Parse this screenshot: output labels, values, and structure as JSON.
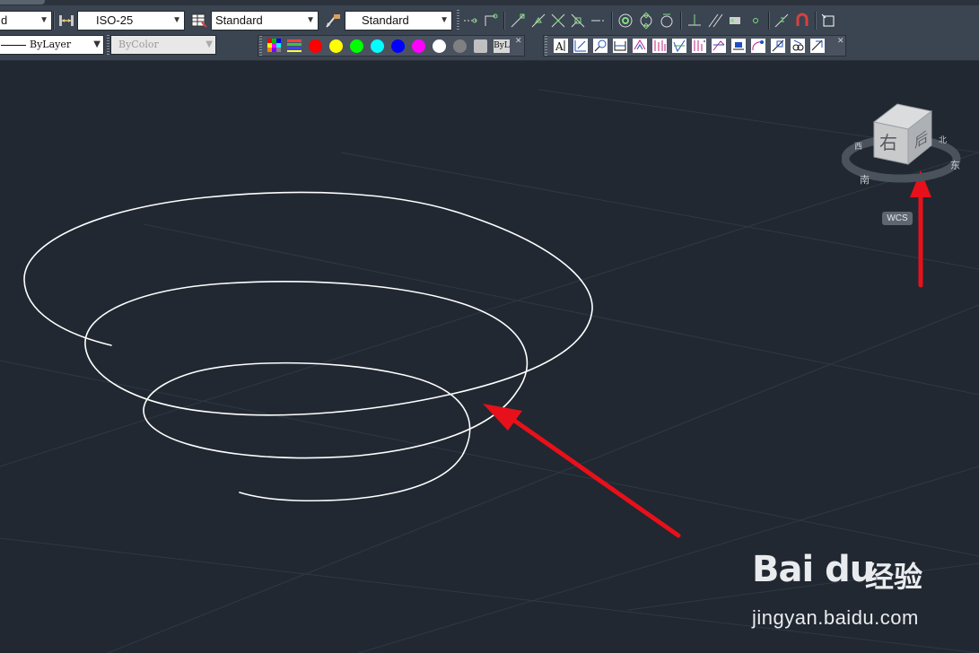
{
  "toolbar_row1": {
    "text_style_value": "d",
    "dim_style_value": "ISO-25",
    "table_style_value": "Standard",
    "multileader_style_value": "Standard"
  },
  "toolbar_row2": {
    "linetype_value": "ByLayer",
    "plotstyle_value": "ByColor",
    "color_bylayer_label": "ByL"
  },
  "colors": {
    "palette": [
      "#ff0000",
      "#ffff00",
      "#00ff00",
      "#00ffff",
      "#0000ff",
      "#ff00ff",
      "#ffffff",
      "#808080",
      "#c0c0c0"
    ],
    "background": "#212831",
    "annotation_arrow": "#e8101a",
    "helix": "#ffffff"
  },
  "viewcube": {
    "face_label": "右",
    "side_label": "后",
    "compass": [
      "南",
      "东",
      "北",
      "西"
    ],
    "wcs_label": "WCS"
  },
  "watermark": {
    "brand": "Bai du",
    "cn": "经验",
    "url": "jingyan.baidu.com"
  }
}
